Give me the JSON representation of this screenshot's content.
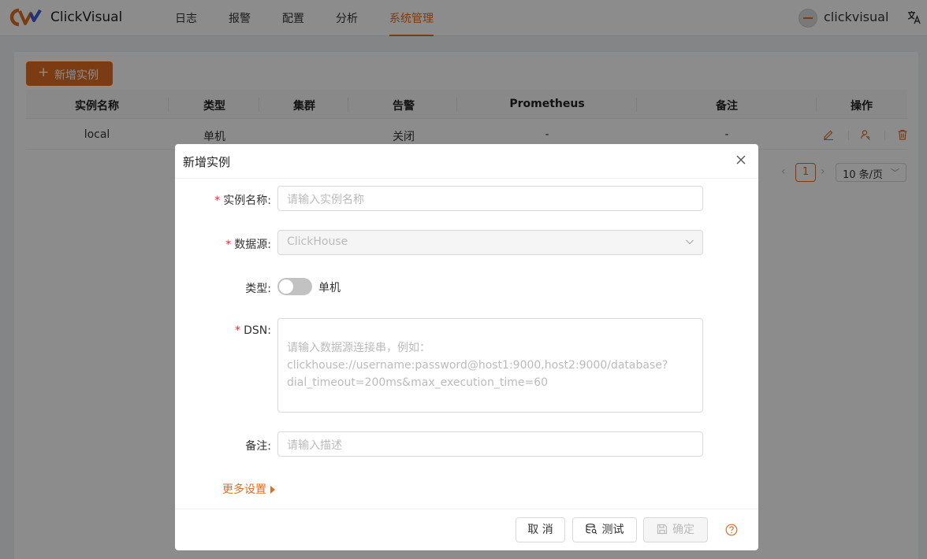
{
  "app": {
    "brand": "ClickVisual"
  },
  "nav": {
    "items": [
      {
        "label": "日志"
      },
      {
        "label": "报警"
      },
      {
        "label": "配置"
      },
      {
        "label": "分析"
      },
      {
        "label": "系统管理"
      }
    ],
    "active": "系统管理"
  },
  "user": {
    "name": "clickvisual"
  },
  "icons": {
    "language": "translate-icon",
    "avatar": "avatar"
  },
  "colors": {
    "accent": "#e06d24",
    "required": "#f5222d"
  },
  "toolbar": {
    "add_label": "新增实例"
  },
  "table": {
    "columns": [
      "实例名称",
      "类型",
      "集群",
      "告警",
      "Prometheus",
      "备注",
      "操作"
    ],
    "rows": [
      {
        "name": "local",
        "type": "单机",
        "cluster": "",
        "alert": "关闭",
        "prometheus": "-",
        "remark": "-"
      }
    ],
    "actions": [
      "edit-icon",
      "auth-icon",
      "delete-icon"
    ]
  },
  "pagination": {
    "prev": "‹",
    "current": "1",
    "next": "›",
    "page_size": "10 条/页"
  },
  "modal": {
    "title": "新增实例",
    "fields": {
      "name": {
        "label": "实例名称",
        "placeholder": "请输入实例名称",
        "required": true
      },
      "datasource": {
        "label": "数据源",
        "value": "ClickHouse",
        "required": true
      },
      "type": {
        "label": "类型",
        "switch_text": "单机",
        "on": false
      },
      "dsn": {
        "label": "DSN",
        "placeholder": "请输入数据源连接串，例如：\nclickhouse://username:password@host1:9000,host2:9000/database?\ndial_timeout=200ms&max_execution_time=60",
        "required": true
      },
      "remark": {
        "label": "备注",
        "placeholder": "请输入描述"
      }
    },
    "more_settings": "更多设置",
    "buttons": {
      "cancel": "取 消",
      "test": "测试",
      "confirm": "确定"
    }
  }
}
